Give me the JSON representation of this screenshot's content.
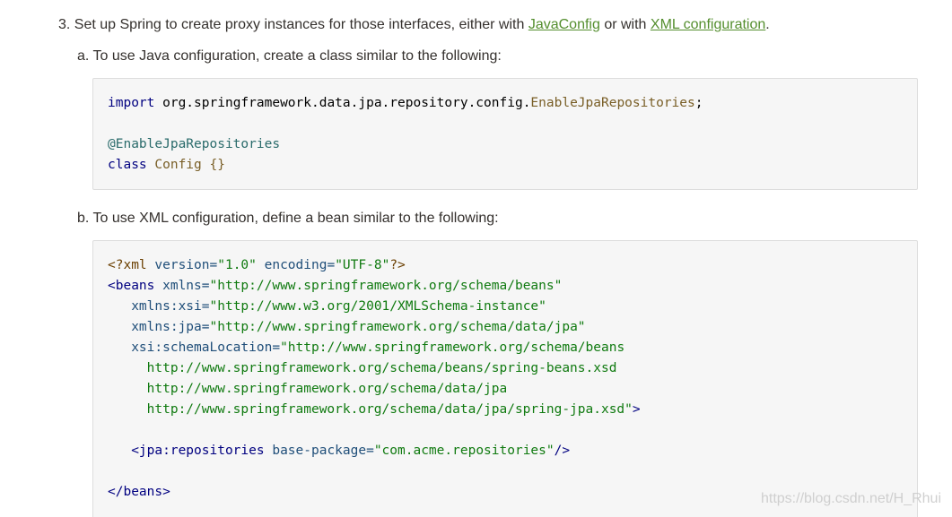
{
  "step": {
    "prefix": "3. Set up Spring to create proxy instances for those interfaces, either with ",
    "link1": "JavaConfig",
    "middle": " or with ",
    "link2": "XML configuration",
    "suffix": "."
  },
  "sub_a": {
    "text": "a. To use Java configuration, create a class similar to the following:",
    "code": {
      "l1_kw": "import",
      "l1_pkg": " org.springframework.data.jpa.repository.config.",
      "l1_cls": "EnableJpaRepositories",
      "l1_end": ";",
      "l3_ann": "@EnableJpaRepositories",
      "l4_kw": "class",
      "l4_cls": " Config ",
      "l4_braces": "{}"
    }
  },
  "sub_b": {
    "text": "b. To use XML configuration, define a bean similar to the following:",
    "code": {
      "l1_open": "<?xml",
      "l1_a1": " version=",
      "l1_v1": "\"1.0\"",
      "l1_a2": " encoding=",
      "l1_v2": "\"UTF-8\"",
      "l1_close": "?>",
      "l2_tag": "<beans",
      "l2_attr": " xmlns=",
      "l2_val": "\"http://www.springframework.org/schema/beans\"",
      "l3_attr": "   xmlns:xsi=",
      "l3_val": "\"http://www.w3.org/2001/XMLSchema-instance\"",
      "l4_attr": "   xmlns:jpa=",
      "l4_val": "\"http://www.springframework.org/schema/data/jpa\"",
      "l5_attr": "   xsi:schemaLocation=",
      "l5_val": "\"http://www.springframework.org/schema/beans",
      "l6_val": "     http://www.springframework.org/schema/beans/spring-beans.xsd",
      "l7_val": "     http://www.springframework.org/schema/data/jpa",
      "l8_val": "     http://www.springframework.org/schema/data/jpa/spring-jpa.xsd\"",
      "l8_close": ">",
      "l10_tag": "   <jpa:repositories",
      "l10_attr": " base-package=",
      "l10_val": "\"com.acme.repositories\"",
      "l10_close": "/>",
      "l12_tag": "</beans>"
    }
  },
  "watermark": "https://blog.csdn.net/H_Rhui"
}
